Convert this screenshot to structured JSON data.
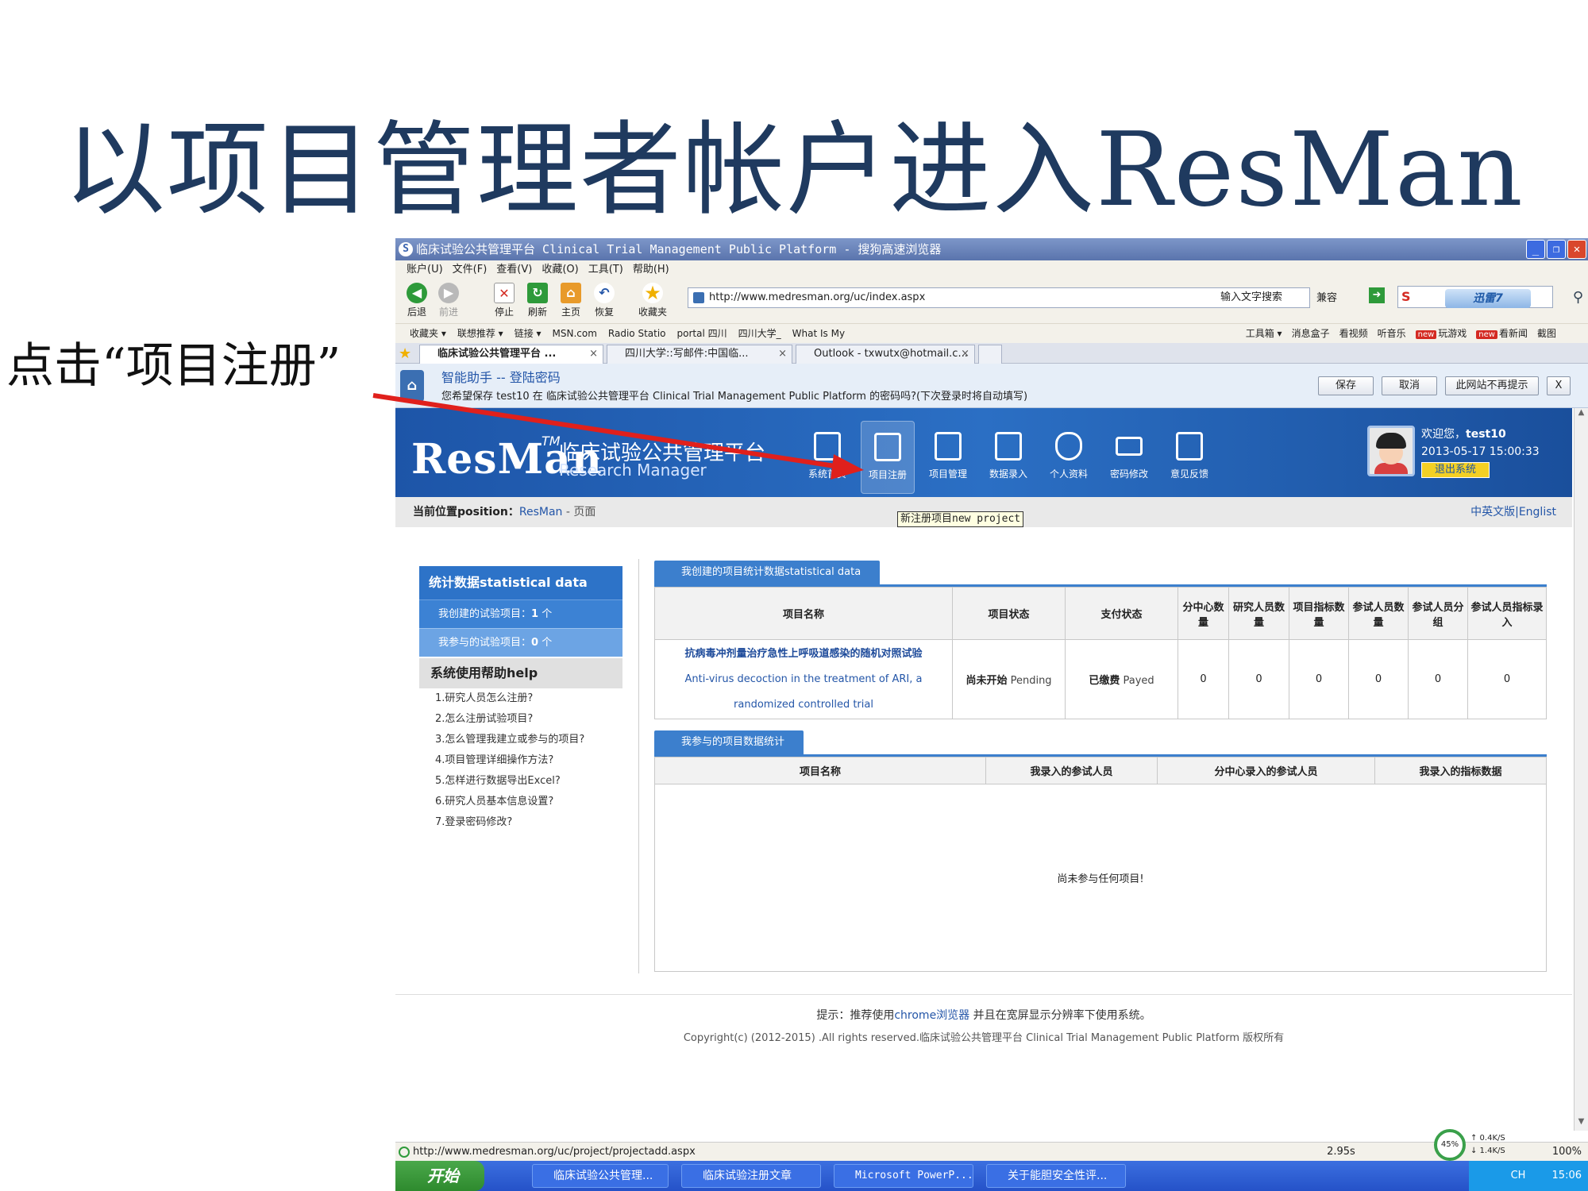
{
  "slide": {
    "title": "以项目管理者帐户进入ResMan",
    "callout": "点击“项目注册”"
  },
  "colors": {
    "accent_blue": "#2456a8",
    "banner_blue": "#1d55a8",
    "arrow_red": "#e0201c"
  },
  "browser": {
    "window_title": "临床试验公共管理平台 Clinical Trial Management Public Platform - 搜狗高速浏览器",
    "menu": [
      "账户(U)",
      "文件(F)",
      "查看(V)",
      "收藏(O)",
      "工具(T)",
      "帮助(H)"
    ],
    "toolbar": {
      "back": "后退",
      "forward": "前进",
      "stop": "停止",
      "refresh": "刷新",
      "home": "主页",
      "restore": "恢复",
      "favorites": "收藏夹"
    },
    "address": "http://www.medresman.org/uc/index.aspx",
    "search_label": "输入文字搜索",
    "compat": "兼容",
    "xunlei": "迅雷7",
    "favbar": {
      "left": [
        "收藏夹 ▾",
        "联想推荐 ▾",
        "链接 ▾",
        "MSN.com",
        "Radio Statio",
        "portal 四川",
        "四川大学_",
        "What Is My"
      ],
      "right": [
        "工具箱 ▾",
        "消息盒子",
        "看视频",
        "听音乐"
      ],
      "new_badge": "new",
      "games": "玩游戏",
      "news": "看新闻",
      "screenshot": "截图"
    },
    "tabs": [
      {
        "label": "临床试验公共管理平台 ..."
      },
      {
        "label": "四川大学::写邮件:中国临..."
      },
      {
        "label": "Outlook - txwutx@hotmail.c..."
      }
    ],
    "tab_close": "×",
    "notify": {
      "title": "智能助手 -- 登陆密码",
      "text": "您希望保存 test10 在 临床试验公共管理平台 Clinical Trial Management Public Platform 的密码吗?(下次登录时将自动填写)",
      "save": "保存",
      "cancel": "取消",
      "never": "此网站不再提示",
      "close": "X"
    },
    "status_url": "http://www.medresman.org/uc/project/projectadd.aspx",
    "status_time": "2.95s",
    "zoom": "100%",
    "net_percent": "45%",
    "net_up": "↑ 0.4K/S",
    "net_down": "↓ 1.4K/S"
  },
  "site": {
    "logo": "ResMan",
    "tm": "TM",
    "name_cn": "临床试验公共管理平台",
    "name_en": "Research Manager",
    "nav": [
      {
        "label": "系统首页",
        "icon": "monitor-icon"
      },
      {
        "label": "项目注册",
        "icon": "document-add-icon"
      },
      {
        "label": "项目管理",
        "icon": "document-lock-icon"
      },
      {
        "label": "数据录入",
        "icon": "notepad-pen-icon"
      },
      {
        "label": "个人资料",
        "icon": "shield-user-icon"
      },
      {
        "label": "密码修改",
        "icon": "keyboard-icon"
      },
      {
        "label": "意见反馈",
        "icon": "notepad-user-icon"
      }
    ],
    "tooltip": "新注册项目new project",
    "welcome": "欢迎您，",
    "user": "test10",
    "datetime": "2013-05-17 15:00:33",
    "logout": "退出系统",
    "crumb_label": "当前位置position：",
    "crumb_link": "ResMan",
    "crumb_page": " - 页面",
    "lang_cn": "中英文版",
    "lang_sep": "|",
    "lang_en": "Englist"
  },
  "sidebar": {
    "stats_title": "统计数据statistical data",
    "created_label": "我创建的试验项目：",
    "created_count": "1",
    "joined_label": "我参与的试验项目：",
    "joined_count": "0",
    "unit": " 个",
    "help_title": "系统使用帮助help",
    "help": [
      "1.研究人员怎么注册?",
      "2.怎么注册试验项目?",
      "3.怎么管理我建立或参与的项目?",
      "4.项目管理详细操作方法?",
      "5.怎样进行数据导出Excel?",
      "6.研究人员基本信息设置?",
      "7.登录密码修改?"
    ]
  },
  "created_panel": {
    "tab": "我创建的项目统计数据statistical data",
    "headers": [
      "项目名称",
      "项目状态",
      "支付状态",
      "分中心数量",
      "研究人员数量",
      "项目指标数量",
      "参试人员数量",
      "参试人员分组",
      "参试人员指标录入"
    ],
    "row": {
      "name_cn": "抗病毒冲剂量治疗急性上呼吸道感染的随机对照试验",
      "name_en": "Anti-virus decoction in the treatment of ARI, a randomized controlled trial",
      "status_cn": "尚未开始",
      "status_en": "Pending",
      "pay_cn": "已缴费",
      "pay_en": "Payed",
      "counts": [
        "0",
        "0",
        "0",
        "0",
        "0",
        "0"
      ]
    }
  },
  "joined_panel": {
    "tab": "我参与的项目数据统计",
    "headers": [
      "项目名称",
      "我录入的参试人员",
      "分中心录入的参试人员",
      "我录入的指标数据"
    ],
    "empty": "尚未参与任何项目!"
  },
  "footer": {
    "tip_prefix": "提示：推荐使用",
    "tip_link": "chrome浏览器",
    "tip_suffix": " 并且在宽屏显示分辨率下使用系统。",
    "copyright": "Copyright(c) (2012-2015) .All rights reserved.临床试验公共管理平台  Clinical Trial Management Public Platform 版权所有"
  },
  "taskbar": {
    "start": "开始",
    "tasks": [
      "临床试验公共管理...",
      "临床试验注册文章",
      "Microsoft PowerP...",
      "关于能胆安全性评..."
    ],
    "tray_lang": "CH",
    "clock": "15:06"
  }
}
